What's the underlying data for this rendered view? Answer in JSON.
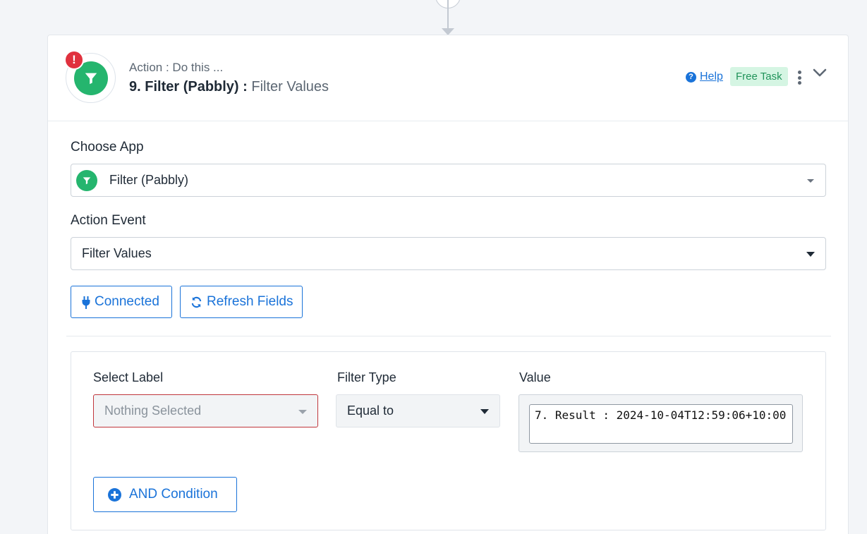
{
  "step": {
    "label": "Action : Do this ...",
    "number_app": "9. Filter (Pabbly) :",
    "event": "Filter Values",
    "error_badge": "!"
  },
  "header_actions": {
    "help_icon": "?",
    "help_label": "Help",
    "task_badge": "Free Task"
  },
  "choose_app": {
    "label": "Choose App",
    "value": "Filter (Pabbly)"
  },
  "action_event": {
    "label": "Action Event",
    "value": "Filter Values"
  },
  "buttons": {
    "connected": "Connected",
    "refresh": "Refresh Fields"
  },
  "filter": {
    "select_label": "Select Label",
    "select_value": "Nothing Selected",
    "filter_type_label": "Filter Type",
    "filter_type_value": "Equal to",
    "value_label": "Value",
    "value_text": "7. Result : 2024-10-04T12:59:06+10:00",
    "and_condition": "AND Condition"
  },
  "colors": {
    "brand_green": "#25b56e",
    "link_blue": "#1a73d9",
    "error_red": "#e0313e",
    "invalid_border": "#c0363c"
  },
  "icons": [
    "filter-icon",
    "error-icon",
    "help-icon",
    "kebab-menu-icon",
    "chevron-down-icon",
    "plug-icon",
    "refresh-icon",
    "plus-circle-icon",
    "caret-down-icon"
  ]
}
